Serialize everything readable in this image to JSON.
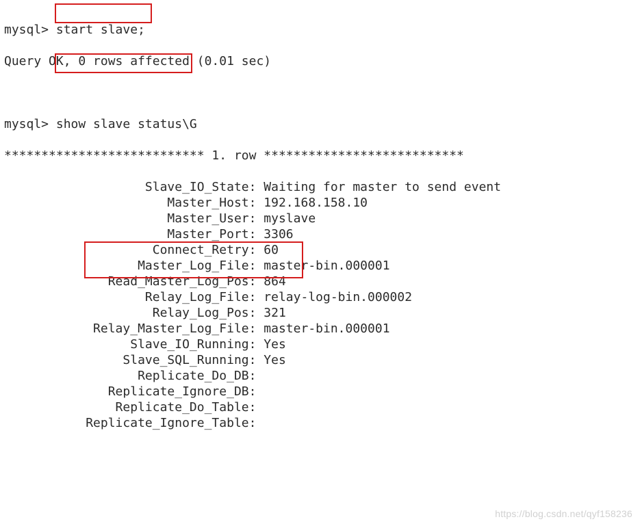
{
  "colors": {
    "highlight_box": "#d51d1d"
  },
  "watermark": "https://blog.csdn.net/qyf158236",
  "prompt": "mysql> ",
  "commands": {
    "start_slave": "start slave;",
    "show_status": "show slave status\\G"
  },
  "responses": {
    "ok": "Query OK, 0 rows affected (0.01 sec)",
    "row_header": "*************************** 1. row ***************************"
  },
  "status_rows": [
    {
      "label": "Slave_IO_State",
      "value": "Waiting for master to send event"
    },
    {
      "label": "Master_Host",
      "value": "192.168.158.10"
    },
    {
      "label": "Master_User",
      "value": "myslave"
    },
    {
      "label": "Master_Port",
      "value": "3306"
    },
    {
      "label": "Connect_Retry",
      "value": "60"
    },
    {
      "label": "Master_Log_File",
      "value": "master-bin.000001"
    },
    {
      "label": "Read_Master_Log_Pos",
      "value": "864"
    },
    {
      "label": "Relay_Log_File",
      "value": "relay-log-bin.000002"
    },
    {
      "label": "Relay_Log_Pos",
      "value": "321"
    },
    {
      "label": "Relay_Master_Log_File",
      "value": "master-bin.000001"
    },
    {
      "label": "Slave_IO_Running",
      "value": "Yes"
    },
    {
      "label": "Slave_SQL_Running",
      "value": "Yes"
    },
    {
      "label": "Replicate_Do_DB",
      "value": ""
    },
    {
      "label": "Replicate_Ignore_DB",
      "value": ""
    },
    {
      "label": "Replicate_Do_Table",
      "value": ""
    },
    {
      "label": "Replicate_Ignore_Table",
      "value": ""
    }
  ],
  "label_width": 33
}
